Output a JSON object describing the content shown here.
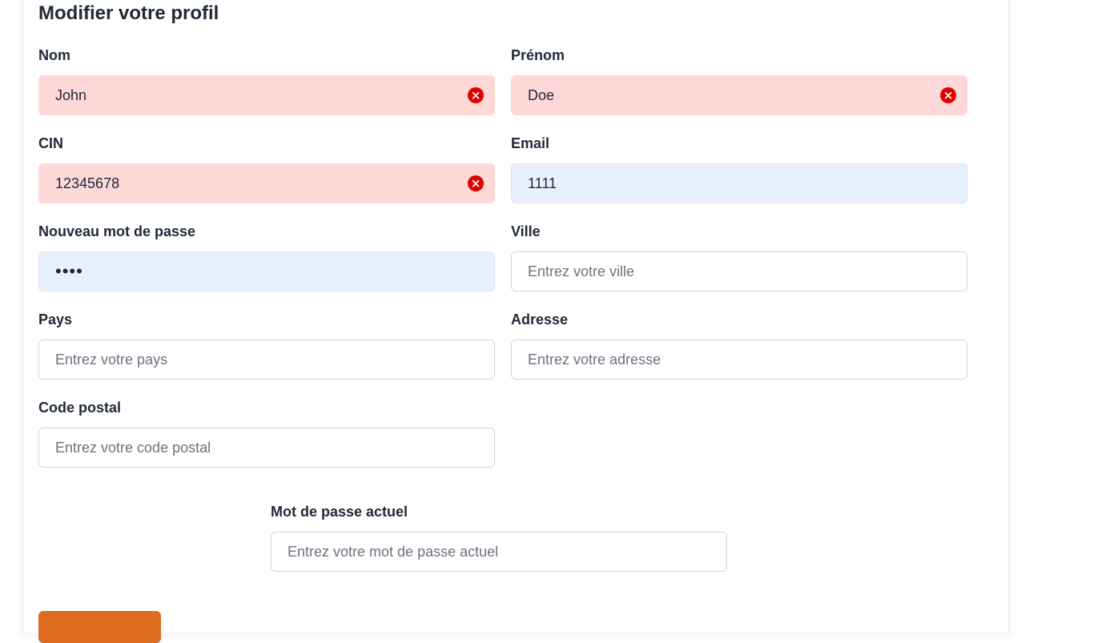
{
  "page": {
    "title": "Modifier votre profil"
  },
  "form": {
    "nom": {
      "label": "Nom",
      "value": "John",
      "state": "error",
      "icon": "error-x-circle-icon"
    },
    "prenom": {
      "label": "Prénom",
      "value": "Doe",
      "state": "error",
      "icon": "error-x-circle-icon"
    },
    "cin": {
      "label": "CIN",
      "value": "12345678",
      "state": "error",
      "icon": "error-x-circle-icon"
    },
    "email": {
      "label": "Email",
      "value": "1111",
      "state": "autofilled"
    },
    "nouveau_mot_de_passe": {
      "label": "Nouveau mot de passe",
      "value": "1111",
      "state": "autofilled"
    },
    "ville": {
      "label": "Ville",
      "value": "",
      "placeholder": "Entrez votre ville"
    },
    "pays": {
      "label": "Pays",
      "value": "",
      "placeholder": "Entrez votre pays"
    },
    "adresse": {
      "label": "Adresse",
      "value": "",
      "placeholder": "Entrez votre adresse"
    },
    "code_postal": {
      "label": "Code postal",
      "value": "",
      "placeholder": "Entrez votre code postal"
    },
    "mot_de_passe_actuel": {
      "label": "Mot de passe actuel",
      "value": "",
      "placeholder": "Entrez votre mot de passe actuel"
    }
  },
  "colors": {
    "error_bg": "#fed7d7",
    "error_icon": "#e00000",
    "autofill_bg": "#e8f0fe",
    "submit_bg": "#dd6b20"
  }
}
